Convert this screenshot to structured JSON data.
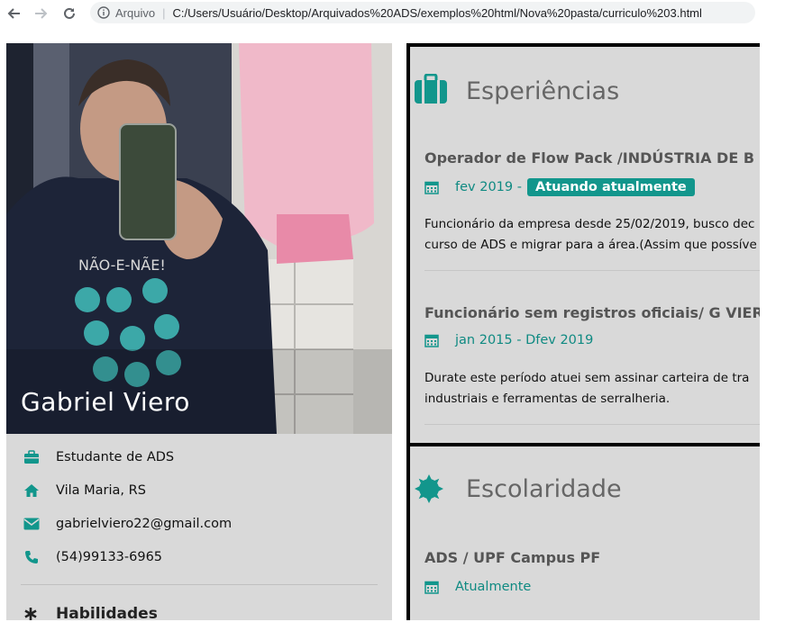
{
  "browser": {
    "info_label": "Arquivo",
    "url": "C:/Users/Usuário/Desktop/Arquivados%20ADS/exemplos%20html/Nova%20pasta/curriculo%203.html"
  },
  "profile": {
    "name": "Gabriel Viero",
    "info": [
      {
        "icon": "briefcase-icon",
        "text": "Estudante de ADS"
      },
      {
        "icon": "home-icon",
        "text": "Vila Maria, RS"
      },
      {
        "icon": "envelope-icon",
        "text": "gabrielviero22@gmail.com"
      },
      {
        "icon": "phone-icon",
        "text": "(54)99133-6965"
      }
    ],
    "skills_title": "Habilidades"
  },
  "experience": {
    "title": "Esperiências",
    "jobs": [
      {
        "title": "Operador de Flow Pack /INDÚSTRIA DE B",
        "date": "fev 2019 -",
        "badge": "Atuando atualmente",
        "desc": [
          "Funcionário da empresa desde 25/02/2019, busco dec",
          "curso de ADS e migrar para a área.(Assim que possíve"
        ]
      },
      {
        "title": "Funcionário sem registros oficiais/ G VIER",
        "date": "jan 2015 - Dfev 2019",
        "desc": [
          "Durate este período atuei sem assinar carteira de tra",
          "industriais e ferramentas de serralheria."
        ]
      }
    ]
  },
  "education": {
    "title": "Escolaridade",
    "item_title": "ADS / UPF Campus PF",
    "item_date": "Atualmente"
  },
  "colors": {
    "accent": "#12968c",
    "panel_bg": "#d9d9d9",
    "title_gray": "#666666"
  }
}
